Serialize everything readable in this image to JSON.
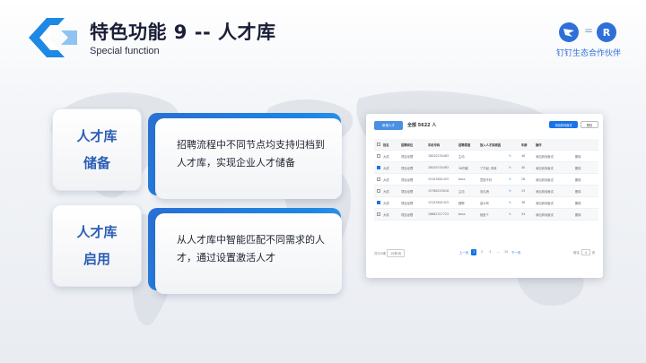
{
  "header": {
    "title": "特色功能 9 -- 人才库",
    "subtitle": "Special function",
    "partner_text": "钉钉生态合作伙伴",
    "partner_equals": "="
  },
  "features": [
    {
      "label_line1": "人才库",
      "label_line2": "储备",
      "desc_line1": "招聘流程中不同节点均支持归档到",
      "desc_line2": "人才库，实现企业人才储备"
    },
    {
      "label_line1": "人才库",
      "label_line2": "启用",
      "desc_line1": "从人才库中智能匹配不同需求的人",
      "desc_line2": "才，通过设置激活人才"
    }
  ],
  "screenshot": {
    "add_button": "新增人才",
    "total": "全部 5622 人",
    "action_button": "添加到待面试",
    "delete_button": "删除",
    "columns": [
      "",
      "姓名",
      "招聘岗位",
      "手机号码",
      "招聘渠道",
      "放入人才库原因",
      "",
      "年龄",
      "操作",
      ""
    ],
    "rows": [
      {
        "checked": false,
        "name": "大成",
        "job": "项目经理",
        "phone": "18020234483",
        "channel": "主动",
        "reason": "",
        "age": "48",
        "op": "添加到待面试",
        "del": "删除"
      },
      {
        "checked": true,
        "name": "大成",
        "job": "项目经理",
        "phone": "18020234483",
        "channel": "58同城",
        "reason": "了不起, 有事",
        "age": "40",
        "op": "添加到待面试",
        "del": "删除"
      },
      {
        "checked": false,
        "name": "大成",
        "job": "项目经理",
        "phone": "15103801425",
        "channel": "boss",
        "reason": "意愿不好",
        "age": "28",
        "op": "添加到待面试",
        "del": "删除"
      },
      {
        "checked": false,
        "name": "大成",
        "job": "项目经理",
        "phone": "15786225016",
        "channel": "主动",
        "reason": "没礼貌",
        "age": "13",
        "op": "添加到待面试",
        "del": "删除"
      },
      {
        "checked": true,
        "name": "大成",
        "job": "项目经理",
        "phone": "15103801425",
        "channel": "猎聘",
        "reason": "高大有",
        "age": "36",
        "op": "添加到待面试",
        "del": "删除"
      },
      {
        "checked": false,
        "name": "大成",
        "job": "项目经理",
        "phone": "18682317723",
        "channel": "boss",
        "reason": "就是个",
        "age": "34",
        "op": "添加到待面试",
        "del": "删除"
      }
    ],
    "footer": {
      "count": "共320条",
      "page_size": "10条/页",
      "prev": "上一页",
      "pages": [
        "1",
        "2",
        "3",
        "...",
        "15"
      ],
      "current_page": "1",
      "next": "下一页",
      "goto_label": "前往",
      "goto_value": "4",
      "goto_unit": "页"
    }
  },
  "colors": {
    "accent": "#2b5fb5",
    "brand_blue": "#1e88e5"
  }
}
